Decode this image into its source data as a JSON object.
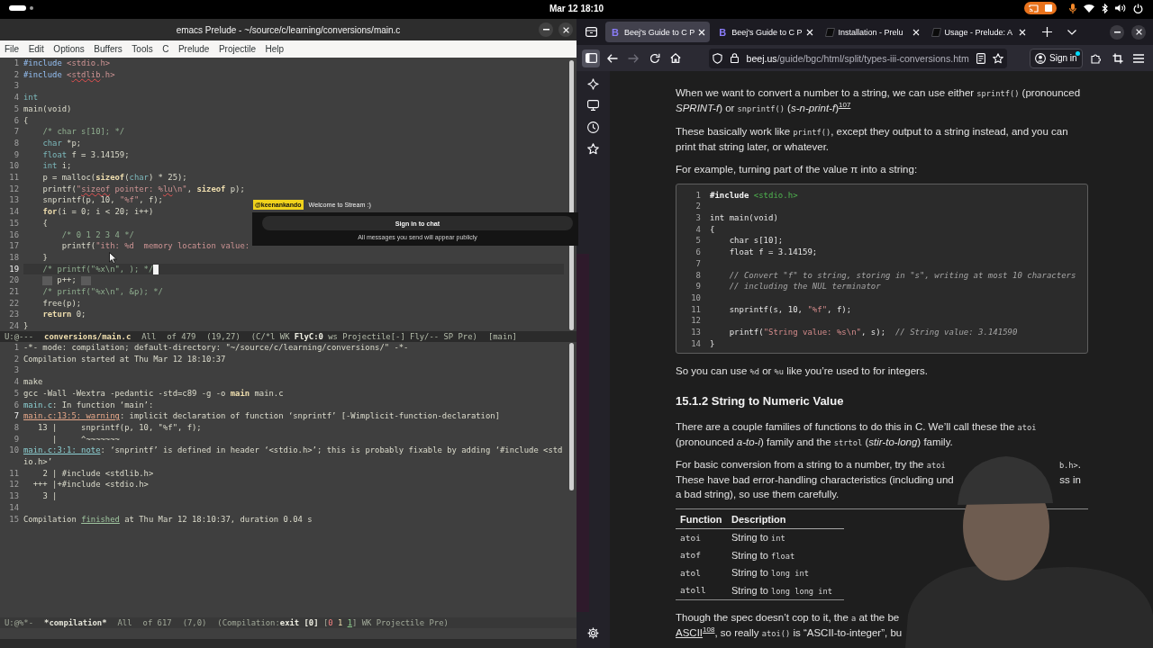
{
  "top_bar": {
    "clock": "Mar 12 18:10"
  },
  "emacs": {
    "title": "emacs Prelude - ~/source/c/learning/conversions/main.c",
    "menu": [
      "File",
      "Edit",
      "Options",
      "Buffers",
      "Tools",
      "C",
      "Prelude",
      "Projectile",
      "Help"
    ],
    "editor": {
      "lines": [
        {
          "number": "1",
          "current": false,
          "tokens": [
            {
              "kind": "preproc",
              "text": "#include"
            },
            {
              "kind": "string",
              "text": " <stdio.h>"
            }
          ]
        },
        {
          "number": "2",
          "current": false,
          "tokens": [
            {
              "kind": "preproc",
              "text": "#include"
            },
            {
              "kind": "string",
              "text": " <"
            },
            {
              "kind": "misspelled",
              "text": "stdlib"
            },
            {
              "kind": "string",
              "text": ".h>"
            }
          ]
        },
        {
          "number": "3",
          "current": false
        },
        {
          "number": "4",
          "current": false,
          "tokens": [
            {
              "kind": "type",
              "text": "int"
            }
          ]
        },
        {
          "number": "5",
          "current": false,
          "tokens": [
            {
              "kind": "plain",
              "text": "main(void)"
            }
          ]
        },
        {
          "number": "6",
          "current": false,
          "tokens": [
            {
              "kind": "plain",
              "text": "{"
            }
          ]
        },
        {
          "number": "7",
          "current": false,
          "tokens": [
            {
              "kind": "comment",
              "text": "    /* char s[10]; */"
            }
          ]
        },
        {
          "number": "8",
          "current": false,
          "tokens": [
            {
              "kind": "type",
              "text": "    char"
            },
            {
              "kind": "plain",
              "text": " *p;"
            }
          ]
        },
        {
          "number": "9",
          "current": false,
          "tokens": [
            {
              "kind": "type",
              "text": "    float"
            },
            {
              "kind": "plain",
              "text": " f = 3.14159;"
            }
          ]
        },
        {
          "number": "10",
          "current": false,
          "tokens": [
            {
              "kind": "type",
              "text": "    int"
            },
            {
              "kind": "plain",
              "text": " i;"
            }
          ]
        },
        {
          "number": "11",
          "current": false,
          "tokens": [
            {
              "kind": "plain",
              "text": "    p = malloc("
            },
            {
              "kind": "keyword",
              "text": "sizeof"
            },
            {
              "kind": "plain",
              "text": "("
            },
            {
              "kind": "type",
              "text": "char"
            },
            {
              "kind": "plain",
              "text": ") * 25);"
            }
          ]
        },
        {
          "number": "12",
          "current": false,
          "tokens": [
            {
              "kind": "plain",
              "text": "    printf("
            },
            {
              "kind": "string",
              "text": "\""
            },
            {
              "kind": "misspelled",
              "text": "sizeof"
            },
            {
              "kind": "string",
              "text": " pointer: %"
            },
            {
              "kind": "misspelled",
              "text": "lu"
            },
            {
              "kind": "string",
              "text": "\\n\""
            },
            {
              "kind": "plain",
              "text": ", "
            },
            {
              "kind": "keyword",
              "text": "sizeof"
            },
            {
              "kind": "plain",
              "text": " p);"
            }
          ]
        },
        {
          "number": "13",
          "current": false,
          "tokens": [
            {
              "kind": "plain",
              "text": "    snprintf(p, 10, "
            },
            {
              "kind": "string",
              "text": "\"%f\""
            },
            {
              "kind": "plain",
              "text": ", f);"
            }
          ]
        },
        {
          "number": "14",
          "current": false,
          "tokens": [
            {
              "kind": "keyword",
              "text": "    for"
            },
            {
              "kind": "plain",
              "text": "(i = 0; i < 20; i++)"
            }
          ]
        },
        {
          "number": "15",
          "current": false,
          "tokens": [
            {
              "kind": "plain",
              "text": "    {"
            }
          ]
        },
        {
          "number": "16",
          "current": false,
          "tokens": [
            {
              "kind": "comment",
              "text": "        /* 0 1 2 3 4 */"
            }
          ]
        },
        {
          "number": "17",
          "current": false,
          "tokens": [
            {
              "kind": "plain",
              "text": "        printf("
            },
            {
              "kind": "string",
              "text": "\"ith: %d  memory location value:"
            }
          ]
        },
        {
          "number": "18",
          "current": false,
          "tokens": [
            {
              "kind": "plain",
              "text": "    }"
            }
          ]
        },
        {
          "number": "19",
          "current": true,
          "tokens": [
            {
              "kind": "comment",
              "text": "    /* printf(\"%x\\n\", ); */"
            },
            {
              "kind": "cursor"
            }
          ]
        },
        {
          "number": "20",
          "current": false,
          "tokens": [
            {
              "kind": "tab"
            },
            {
              "kind": "plain",
              "text": "p++;"
            },
            {
              "kind": "tab"
            }
          ]
        },
        {
          "number": "21",
          "current": false,
          "tokens": [
            {
              "kind": "comment",
              "text": "    /* printf(\"%x\\n\", &p); */"
            }
          ]
        },
        {
          "number": "22",
          "current": false,
          "tokens": [
            {
              "kind": "plain",
              "text": "    free(p);"
            }
          ]
        },
        {
          "number": "23",
          "current": false,
          "tokens": [
            {
              "kind": "keyword",
              "text": "    return"
            },
            {
              "kind": "plain",
              "text": " 0;"
            }
          ]
        },
        {
          "number": "24",
          "current": false,
          "tokens": [
            {
              "kind": "plain",
              "text": "}"
            }
          ]
        }
      ]
    },
    "mode_line": {
      "active": true,
      "items": [
        {
          "kind": "info",
          "text": "U:@---"
        },
        {
          "kind": "buffer",
          "text": "conversions/main.c"
        },
        {
          "kind": "info",
          "text": "All"
        },
        {
          "kind": "info",
          "text": "of 479"
        },
        {
          "kind": "info",
          "text": "(19,27)"
        },
        {
          "kind": "modes",
          "tokens": [
            {
              "kind": "plain",
              "text": "(C/*l WK "
            },
            {
              "kind": "bold",
              "text": "FlyC:0"
            },
            {
              "kind": "plain",
              "text": " ws Projectile[-] Fly/-- SP Pre)"
            }
          ]
        },
        {
          "kind": "info",
          "text": "[main]"
        }
      ]
    },
    "compilation": {
      "lines": [
        {
          "number": "1",
          "current": false,
          "tokens": [
            {
              "kind": "plain",
              "text": "-*- mode: compilation; default-directory: \"~/source/c/learning/conversions/\" -*-"
            }
          ]
        },
        {
          "number": "2",
          "current": false,
          "tokens": [
            {
              "kind": "plain",
              "text": "Compilation started at Thu Mar 12 18:10:37"
            }
          ]
        },
        {
          "number": "3",
          "current": false
        },
        {
          "number": "4",
          "current": false,
          "tokens": [
            {
              "kind": "plain",
              "text": "make"
            }
          ]
        },
        {
          "number": "5",
          "current": false,
          "tokens": [
            {
              "kind": "plain",
              "text": "gcc -Wall -Wextra -pedantic -std=c89 -g -o "
            },
            {
              "kind": "bold",
              "text": "main"
            },
            {
              "kind": "plain",
              "text": " main.c"
            }
          ]
        },
        {
          "number": "6",
          "current": false,
          "tokens": [
            {
              "kind": "file",
              "text": "main.c"
            },
            {
              "kind": "plain",
              "text": ": In function ‘main’:"
            }
          ]
        },
        {
          "number": "7",
          "current": true,
          "tokens": [
            {
              "kind": "warning",
              "text": "main.c:13:5: warning"
            },
            {
              "kind": "plain",
              "text": ": implicit declaration of function ‘snprintf’ [-Wimplicit-function-declaration]"
            }
          ]
        },
        {
          "number": "8",
          "current": false,
          "tokens": [
            {
              "kind": "plain",
              "text": "   13 |     snprintf(p, 10, \"%f\", f);"
            }
          ]
        },
        {
          "number": "9",
          "current": false,
          "tokens": [
            {
              "kind": "plain",
              "text": "      |     ^~~~~~~~"
            }
          ]
        },
        {
          "number": "10",
          "current": false,
          "tokens": [
            {
              "kind": "note",
              "text": "main.c:3:1: note"
            },
            {
              "kind": "plain",
              "text": ": ‘snprintf’ is defined in header ‘<stdio.h>’; this is probably fixable by adding ‘#include <stdio.h>’"
            }
          ]
        },
        {
          "number": "11",
          "current": false,
          "tokens": [
            {
              "kind": "plain",
              "text": "    2 | #include <stdlib.h>"
            }
          ]
        },
        {
          "number": "12",
          "current": false,
          "tokens": [
            {
              "kind": "plain",
              "text": "  +++ |+#include <stdio.h>"
            }
          ]
        },
        {
          "number": "13",
          "current": false,
          "tokens": [
            {
              "kind": "plain",
              "text": "    3 |"
            }
          ]
        },
        {
          "number": "14",
          "current": false
        },
        {
          "number": "15",
          "current": false,
          "tokens": [
            {
              "kind": "plain",
              "text": "Compilation "
            },
            {
              "kind": "success",
              "text": "finished"
            },
            {
              "kind": "plain",
              "text": " at Thu Mar 12 18:10:37, duration 0.04 s"
            }
          ]
        }
      ]
    },
    "compilation_mode_line": {
      "active": false,
      "items": [
        {
          "kind": "info",
          "text": "U:@%*-"
        },
        {
          "kind": "buffer",
          "text": "*compilation*"
        },
        {
          "kind": "info",
          "text": "All"
        },
        {
          "kind": "info",
          "text": "of 617"
        },
        {
          "kind": "info",
          "text": "(7,0)"
        },
        {
          "kind": "modes",
          "tokens": [
            {
              "kind": "plain",
              "text": "(Compilation:"
            },
            {
              "kind": "bold",
              "text": "exit [0]"
            },
            {
              "kind": "plain",
              "text": " ["
            },
            {
              "kind": "error",
              "text": "0"
            },
            {
              "kind": "warning",
              "text": " 1 "
            },
            {
              "kind": "info",
              "text": "1"
            },
            {
              "kind": "plain",
              "text": "] WK Projectile Pre)"
            }
          ]
        }
      ]
    }
  },
  "chat_overlay": {
    "username": "@keenankando",
    "message": "Welcome to Stream :)",
    "button": "Sign in to chat",
    "notice": "All messages you send will appear publicly"
  },
  "browser": {
    "tabs": [
      {
        "title": "Beej's Guide to C P",
        "selected": true,
        "favicon": {
          "kind": "letter",
          "text": "B"
        }
      },
      {
        "title": "Beej's Guide to C P",
        "selected": false,
        "favicon": {
          "kind": "letter",
          "text": "B"
        }
      },
      {
        "title": "Installation - Prelu",
        "selected": false,
        "favicon": {
          "kind": "logo"
        }
      },
      {
        "title": "Usage - Prelude: A",
        "selected": false,
        "favicon": {
          "kind": "logo"
        }
      }
    ],
    "sidebar_open": true,
    "forward_button": {
      "disabled": true
    },
    "address": {
      "domain": "beej.us",
      "path": "/guide/bgc/html/split/types-iii-conversions.htm"
    },
    "sign_in": {
      "label": "Sign in",
      "notification": true
    },
    "page": {
      "blocks": [
        {
          "kind": "paragraph",
          "runs": [
            {
              "kind": "text",
              "text": "When we want to convert a number to a string, we can use either "
            },
            {
              "kind": "code",
              "text": "sprintf()"
            },
            {
              "kind": "text",
              "text": " (pronounced "
            },
            {
              "kind": "em",
              "text": "SPRINT-f"
            },
            {
              "kind": "text",
              "text": ") or "
            },
            {
              "kind": "code",
              "text": "snprintf()"
            },
            {
              "kind": "text",
              "text": " ("
            },
            {
              "kind": "em",
              "text": "s-n-print-f"
            },
            {
              "kind": "text",
              "text": ")"
            },
            {
              "kind": "footnote",
              "text": "107"
            }
          ]
        },
        {
          "kind": "paragraph",
          "runs": [
            {
              "kind": "text",
              "text": "These basically work like "
            },
            {
              "kind": "code",
              "text": "printf()"
            },
            {
              "kind": "text",
              "text": ", except they output to a string instead, and you can print that string later, or whatever."
            }
          ]
        },
        {
          "kind": "paragraph",
          "runs": [
            {
              "kind": "text",
              "text": "For example, turning part of the value π into a string:"
            }
          ]
        },
        {
          "kind": "code",
          "lines": [
            {
              "number": "1",
              "tokens": [
                {
                  "kind": "keyword",
                  "text": "#include"
                },
                {
                  "kind": "header",
                  "text": " <stdio.h>"
                }
              ]
            },
            {
              "number": "2"
            },
            {
              "number": "3",
              "tokens": [
                {
                  "kind": "plain",
                  "text": "int main(void)"
                }
              ]
            },
            {
              "number": "4",
              "tokens": [
                {
                  "kind": "plain",
                  "text": "{"
                }
              ]
            },
            {
              "number": "5",
              "tokens": [
                {
                  "kind": "plain",
                  "text": "    char s[10];"
                }
              ]
            },
            {
              "number": "6",
              "tokens": [
                {
                  "kind": "plain",
                  "text": "    float f = 3.14159;"
                }
              ]
            },
            {
              "number": "7"
            },
            {
              "number": "8",
              "tokens": [
                {
                  "kind": "comment",
                  "text": "    // Convert \"f\" to string, storing in \"s\", writing at most 10 characters"
                }
              ]
            },
            {
              "number": "9",
              "tokens": [
                {
                  "kind": "comment",
                  "text": "    // including the NUL terminator"
                }
              ]
            },
            {
              "number": "10"
            },
            {
              "number": "11",
              "tokens": [
                {
                  "kind": "plain",
                  "text": "    snprintf(s, 10, "
                },
                {
                  "kind": "string",
                  "text": "\"%f\""
                },
                {
                  "kind": "plain",
                  "text": ", f);"
                }
              ]
            },
            {
              "number": "12"
            },
            {
              "number": "13",
              "tokens": [
                {
                  "kind": "plain",
                  "text": "    printf("
                },
                {
                  "kind": "string",
                  "text": "\"String value: %s\\n\""
                },
                {
                  "kind": "plain",
                  "text": ", s);  "
                },
                {
                  "kind": "comment",
                  "text": "// String value: 3.141590"
                }
              ]
            },
            {
              "number": "14",
              "tokens": [
                {
                  "kind": "plain",
                  "text": "}"
                }
              ]
            }
          ]
        },
        {
          "kind": "paragraph",
          "runs": [
            {
              "kind": "text",
              "text": "So you can use "
            },
            {
              "kind": "code",
              "text": "%d"
            },
            {
              "kind": "text",
              "text": " or "
            },
            {
              "kind": "code",
              "text": "%u"
            },
            {
              "kind": "text",
              "text": " like you’re used to for integers."
            }
          ]
        },
        {
          "kind": "heading",
          "text": "15.1.2 String to Numeric Value"
        },
        {
          "kind": "paragraph",
          "runs": [
            {
              "kind": "text",
              "text": "There are a couple families of functions to do this in C. We’ll call these the "
            },
            {
              "kind": "code",
              "text": "atoi"
            },
            {
              "kind": "text",
              "text": " (pronounced "
            },
            {
              "kind": "em",
              "text": "a-to-i"
            },
            {
              "kind": "text",
              "text": ") family and the "
            },
            {
              "kind": "code",
              "text": "strtol"
            },
            {
              "kind": "text",
              "text": " ("
            },
            {
              "kind": "em",
              "text": "stir-to-long"
            },
            {
              "kind": "text",
              "text": ") family."
            }
          ]
        },
        {
          "kind": "clipped_paragraph",
          "lines": [
            {
              "left": [
                {
                  "kind": "text",
                  "text": "For basic conversion from a string to a number, try the "
                },
                {
                  "kind": "code",
                  "text": "atoi"
                }
              ],
              "right": [
                {
                  "kind": "code",
                  "text": "b.h>"
                },
                {
                  "kind": "text",
                  "text": "."
                }
              ]
            },
            {
              "left": [
                {
                  "kind": "text",
                  "text": "These have bad error-handling characteristics (including und"
                }
              ],
              "right": [
                {
                  "kind": "text",
                  "text": "ss in"
                }
              ]
            },
            {
              "left": [
                {
                  "kind": "text",
                  "text": "a bad string), so use them carefully."
                }
              ]
            }
          ]
        },
        {
          "kind": "table",
          "columns": [
            "Function",
            "Description"
          ],
          "rows": [
            {
              "function": "atoi",
              "description": [
                {
                  "kind": "text",
                  "text": "String to "
                },
                {
                  "kind": "code",
                  "text": "int"
                }
              ]
            },
            {
              "function": "atof",
              "description": [
                {
                  "kind": "text",
                  "text": "String to "
                },
                {
                  "kind": "code",
                  "text": "float"
                }
              ]
            },
            {
              "function": "atol",
              "description": [
                {
                  "kind": "text",
                  "text": "String to "
                },
                {
                  "kind": "code",
                  "text": "long int"
                }
              ]
            },
            {
              "function": "atoll",
              "description": [
                {
                  "kind": "text",
                  "text": "String to "
                },
                {
                  "kind": "code",
                  "text": "long long int"
                }
              ]
            }
          ]
        },
        {
          "kind": "clipped_paragraph",
          "lines": [
            {
              "left": [
                {
                  "kind": "text",
                  "text": "Though the spec doesn’t cop to it, the "
                },
                {
                  "kind": "code",
                  "text": "a"
                },
                {
                  "kind": "text",
                  "text": " at the be"
                }
              ]
            },
            {
              "left": [
                {
                  "kind": "link",
                  "text": "ASCII"
                },
                {
                  "kind": "footnote",
                  "text": "108"
                },
                {
                  "kind": "text",
                  "text": ", so really "
                },
                {
                  "kind": "code",
                  "text": "atoi()"
                },
                {
                  "kind": "text",
                  "text": " is “ASCII-to-integer”, bu"
                }
              ]
            }
          ]
        }
      ]
    }
  }
}
